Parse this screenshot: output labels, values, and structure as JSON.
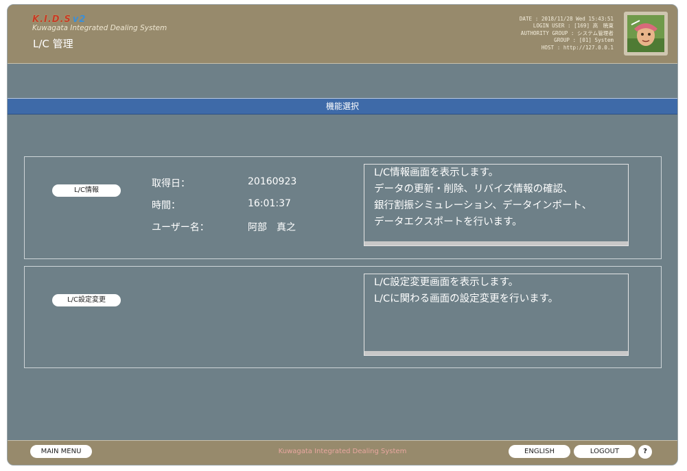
{
  "header": {
    "logo_main": "K.I.D.S",
    "logo_version": "v2",
    "logo_subtitle": "Kuwagata Integrated Dealing System",
    "page_title": "L/C 管理",
    "info": {
      "date": "DATE : 2018/11/28 Wed 15:43:51",
      "login_user": "LOGIN USER : [169] 高　暁東",
      "authority_group": "AUTHORITY GROUP : システム管理者",
      "group": "GROUP : [01] System",
      "host": "HOST : http://127.0.0.1"
    }
  },
  "band": {
    "title": "機能選択"
  },
  "lc_info": {
    "button_label": "L/C情報",
    "acquired_date_label": "取得日：",
    "acquired_date_value": "20160923",
    "time_label": "時間：",
    "time_value": "16:01:37",
    "user_label": "ユーザー名：",
    "user_value": "阿部　真之",
    "description": [
      "L/C情報画面を表示します。",
      "データの更新・削除、リバイズ情報の確認、",
      "銀行割振シミュレーション、データインポート、",
      "データエクスポートを行います。"
    ]
  },
  "lc_settings": {
    "button_label": "L/C設定変更",
    "description": [
      "L/C設定変更画面を表示します。",
      "L/Cに関わる画面の設定変更を行います。"
    ]
  },
  "footer": {
    "main_menu_label": "MAIN MENU",
    "center_text": "Kuwagata Integrated Dealing System",
    "english_label": "ENGLISH",
    "logout_label": "LOGOUT",
    "help_label": "?"
  },
  "colors": {
    "header_bg": "#978a6c",
    "body_bg": "#6e8088",
    "band_bg": "#3e6aa8"
  }
}
